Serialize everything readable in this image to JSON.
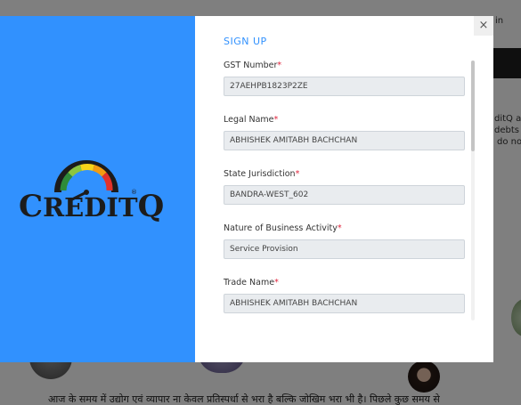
{
  "background": {
    "topright_fragment": "in",
    "side_lines": [
      "ditQ as",
      "debts",
      "do no"
    ],
    "hindi_text": "आज के समय में उद्योग एवं व्यापार ना केवल प्रतिस्पर्धा से भरा है बल्कि जोखिम भरा भी है। पिछले कुछ समय से"
  },
  "brand": {
    "logo_text": "CREDITQ",
    "logo_text_prefix": "C",
    "logo_text_rest": "REDIT",
    "logo_text_suffix": "Q",
    "logo_mark": "®",
    "gauge_label": "SCORE",
    "panel_color": "#3191fe"
  },
  "modal": {
    "close_label": "×",
    "title": "SIGN UP",
    "required_marker": "*",
    "fields": [
      {
        "label": "GST Number",
        "value": "27AEHPB1823P2ZE"
      },
      {
        "label": "Legal Name",
        "value": "ABHISHEK AMITABH BACHCHAN"
      },
      {
        "label": "State Jurisdiction",
        "value": "BANDRA-WEST_602"
      },
      {
        "label": "Nature of Business Activity",
        "value": "Service Provision"
      },
      {
        "label": "Trade Name",
        "value": "ABHISHEK AMITABH BACHCHAN"
      }
    ]
  }
}
